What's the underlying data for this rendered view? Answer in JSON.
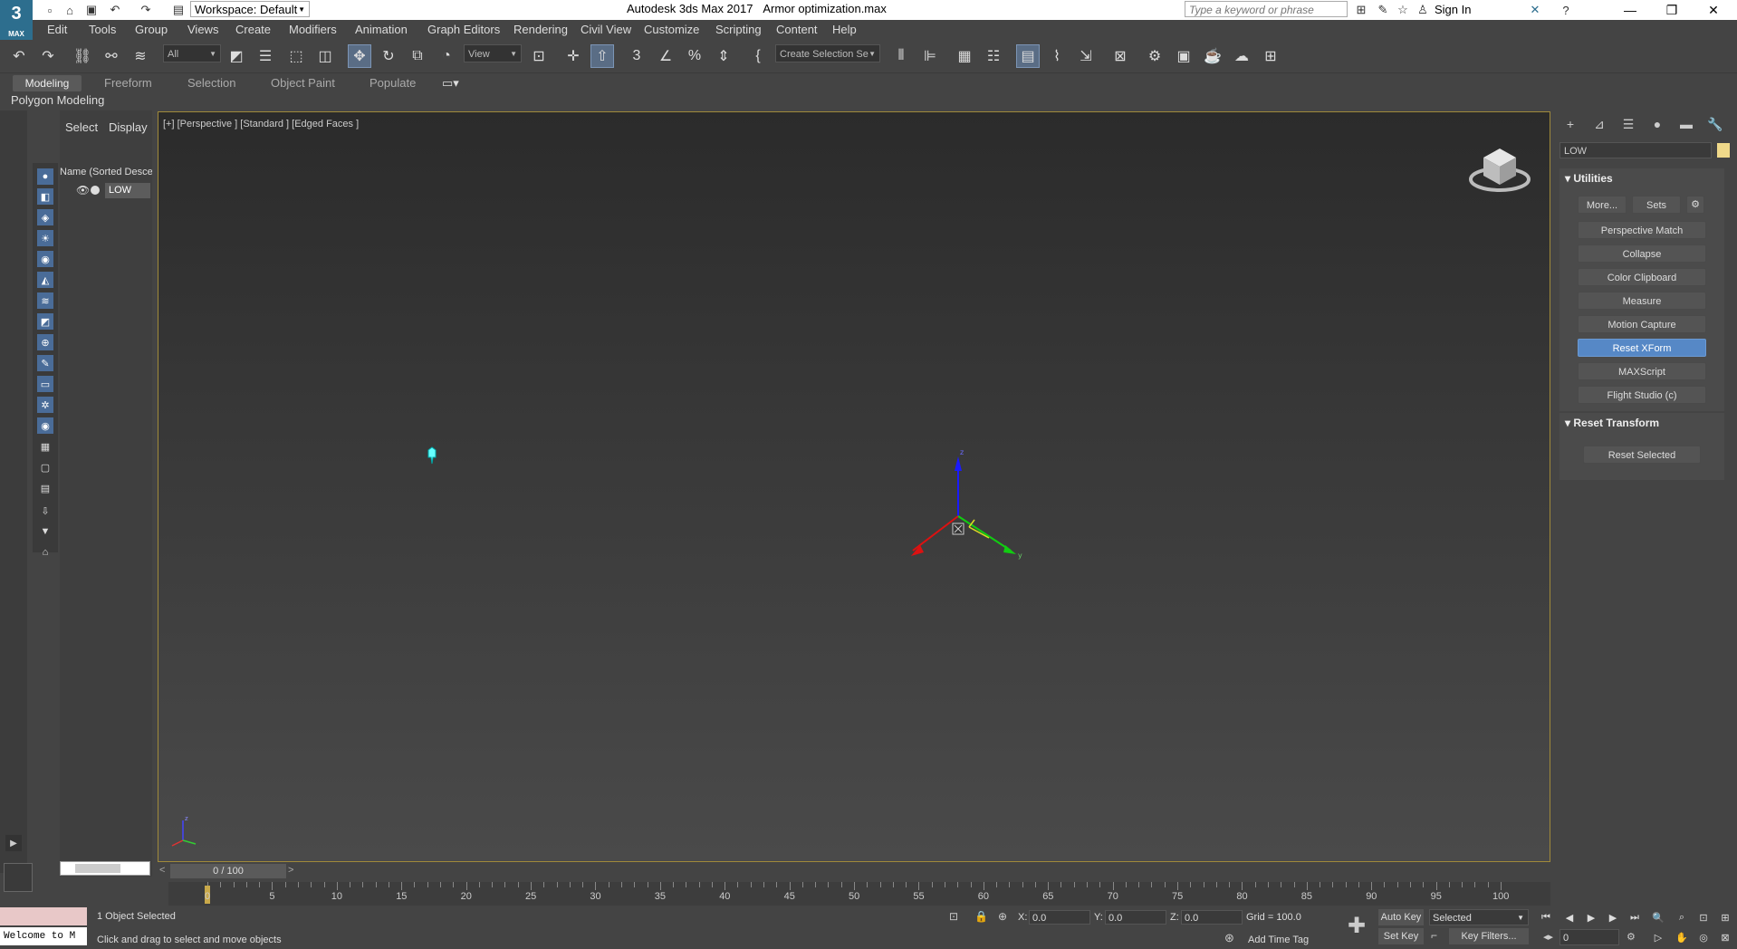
{
  "app": {
    "logo_text": "3",
    "logo_sub": "MAX",
    "workspace": "Workspace: Default",
    "title": "Autodesk 3ds Max 2017",
    "file": "Armor optimization.max",
    "search_placeholder": "Type a keyword or phrase",
    "sign_in": "Sign In"
  },
  "menu": [
    "Edit",
    "Tools",
    "Group",
    "Views",
    "Create",
    "Modifiers",
    "Animation",
    "Graph Editors",
    "Rendering",
    "Civil View",
    "Customize",
    "Scripting",
    "Content",
    "Help"
  ],
  "toolbar": {
    "filter": "All",
    "ref_coord": "View",
    "selection_set": "Create Selection Se"
  },
  "ribbon": {
    "tabs": [
      "Modeling",
      "Freeform",
      "Selection",
      "Object Paint",
      "Populate"
    ],
    "panel": "Polygon Modeling"
  },
  "scene_explorer": {
    "tabs": [
      "Select",
      "Display"
    ],
    "column": "Name (Sorted Descer",
    "objects": [
      "LOW"
    ]
  },
  "viewport": {
    "label": "[+] [Perspective ] [Standard ] [Edged Faces ]"
  },
  "command_panel": {
    "name": "LOW",
    "name_color": "#f0d98a",
    "utilities_title": "Utilities",
    "more_btn": "More...",
    "sets_btn": "Sets",
    "utilities": [
      "Perspective Match",
      "Collapse",
      "Color Clipboard",
      "Measure",
      "Motion Capture",
      "Reset XForm",
      "MAXScript",
      "Flight Studio (c)"
    ],
    "active_utility": "Reset XForm",
    "reset_title": "Reset Transform",
    "reset_selected": "Reset Selected"
  },
  "timeline": {
    "slider": "0 / 100",
    "ticks": [
      "0",
      "5",
      "10",
      "15",
      "20",
      "25",
      "30",
      "35",
      "40",
      "45",
      "50",
      "55",
      "60",
      "65",
      "70",
      "75",
      "80",
      "85",
      "90",
      "95",
      "100"
    ]
  },
  "status": {
    "welcome": "Welcome to M",
    "objects_selected": "1 Object Selected",
    "prompt": "Click and drag to select and move objects",
    "x_label": "X:",
    "x": "0.0",
    "y_label": "Y:",
    "y": "0.0",
    "z_label": "Z:",
    "z": "0.0",
    "grid": "Grid = 100.0",
    "add_time_tag": "Add Time Tag",
    "auto_key": "Auto Key",
    "set_key": "Set Key",
    "key_mode": "Selected",
    "key_filters": "Key Filters...",
    "frame": "0"
  }
}
